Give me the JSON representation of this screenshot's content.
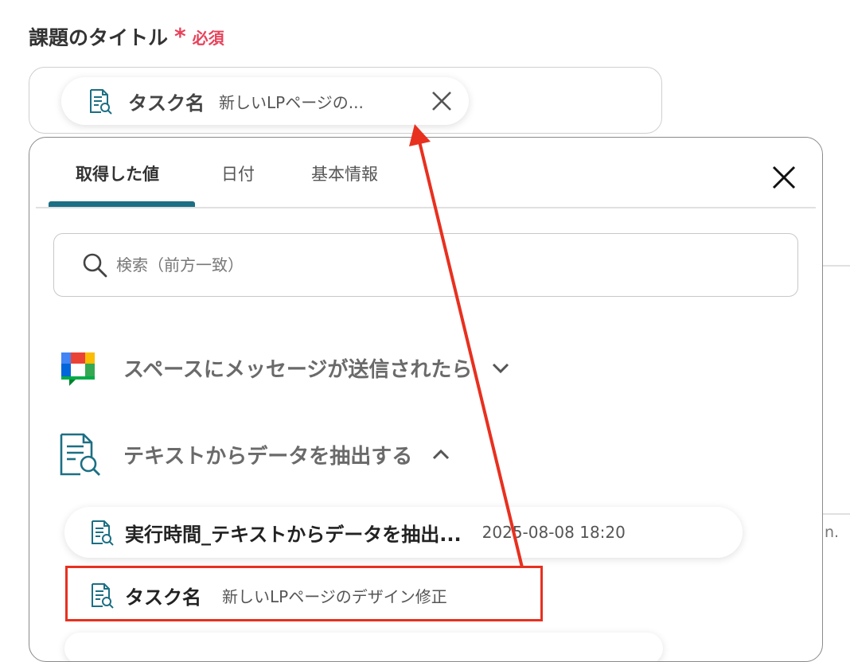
{
  "field": {
    "label": "課題のタイトル",
    "required_mark": "*",
    "required_text": "必須"
  },
  "chip": {
    "icon": "document-search-icon",
    "name": "タスク名",
    "value": "新しいLPページの..."
  },
  "panel": {
    "tabs": [
      {
        "label": "取得した値",
        "active": true
      },
      {
        "label": "日付",
        "active": false
      },
      {
        "label": "基本情報",
        "active": false
      }
    ],
    "search": {
      "placeholder": "検索（前方一致）",
      "value": ""
    },
    "sections": [
      {
        "title": "スペースにメッセージが送信されたら",
        "icon": "google-chat-icon",
        "expanded": false
      },
      {
        "title": "テキストからデータを抽出する",
        "icon": "document-search-icon",
        "expanded": true
      }
    ],
    "items": [
      {
        "name": "実行時間_テキストからデータを抽出...",
        "value": "2025-08-08 18:20"
      },
      {
        "name": "タスク名",
        "value": "新しいLPページのデザイン修正"
      }
    ]
  },
  "background_text": "n.",
  "colors": {
    "accent": "#1c6f84",
    "required": "#e8425a",
    "annotation": "#e8301f"
  }
}
